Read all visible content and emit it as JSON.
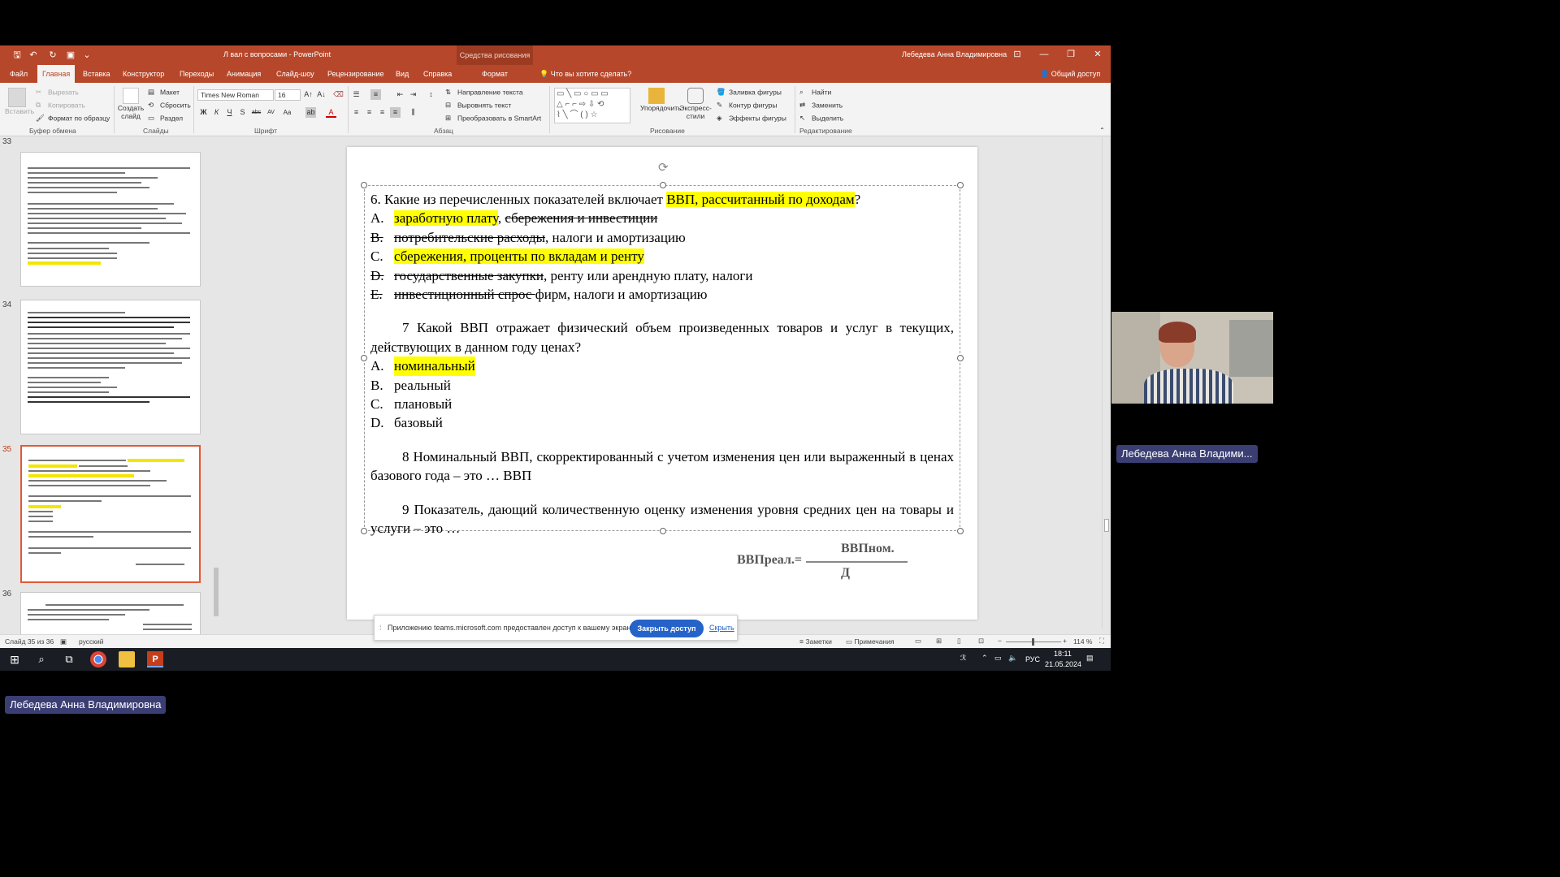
{
  "window": {
    "app_title": "Л вал с вопросами  -  PowerPoint",
    "context_tab_title": "Средства рисования",
    "user_name": "Лебедева Анна Владимировна"
  },
  "tabs": [
    "Файл",
    "Главная",
    "Вставка",
    "Конструктор",
    "Переходы",
    "Анимация",
    "Слайд-шоу",
    "Рецензирование",
    "Вид",
    "Справка",
    "Формат"
  ],
  "tell_me": "Что вы хотите сделать?",
  "share_label": "Общий доступ",
  "ribbon": {
    "clipboard": {
      "paste": "Вставить",
      "cut": "Вырезать",
      "copy": "Копировать",
      "format_painter": "Формат по образцу",
      "group": "Буфер обмена"
    },
    "slides": {
      "layout": "Макет",
      "reset": "Сбросить",
      "new_slide_line1": "Создать",
      "new_slide_line2": "слайд",
      "section": "Раздел",
      "group": "Слайды"
    },
    "font": {
      "name": "Times New Roman",
      "size": "16",
      "bold": "Ж",
      "italic": "К",
      "underline": "Ч",
      "shadow": "S",
      "strike": "abc",
      "spacing": "AV",
      "case": "Aa",
      "group": "Шрифт"
    },
    "paragraph": {
      "text_direction": "Направление текста",
      "align_text": "Выровнять текст",
      "smartart": "Преобразовать в SmartArt",
      "group": "Абзац"
    },
    "drawing": {
      "arrange_line1": "Упорядочить",
      "quick_styles_line1": "Экспресс-",
      "quick_styles_line2": "стили",
      "fill": "Заливка фигуры",
      "outline": "Контур фигуры",
      "effects": "Эффекты фигуры",
      "group": "Рисование"
    },
    "editing": {
      "find": "Найти",
      "replace": "Заменить",
      "select": "Выделить",
      "group": "Редактирование"
    }
  },
  "thumbnails": [
    {
      "number": "33"
    },
    {
      "number": "34"
    },
    {
      "number": "35"
    },
    {
      "number": "36"
    }
  ],
  "slide": {
    "q6": {
      "prefix": "6. Какие из перечисленных показателей включает ",
      "highlight": "ВВП, рассчитанный по доходам",
      "suffix": "?"
    },
    "q6_options": [
      {
        "letter": "A.",
        "parts": [
          {
            "t": "заработную плату",
            "s": "hl"
          },
          {
            "t": ", ",
            "s": ""
          },
          {
            "t": "сбережения и инвестиции",
            "s": "st"
          }
        ]
      },
      {
        "letter": "B.",
        "parts": [
          {
            "t": "потребительские расходы",
            "s": "st"
          },
          {
            "t": ", налоги и амортизацию",
            "s": ""
          }
        ]
      },
      {
        "letter": "C.",
        "parts": [
          {
            "t": "сбережения, проценты по вкладам и ренту",
            "s": "hl"
          }
        ]
      },
      {
        "letter": "D.",
        "parts": [
          {
            "t": "государственные закупки",
            "s": "st"
          },
          {
            "t": ", ренту или арендную плату, налоги",
            "s": ""
          }
        ]
      },
      {
        "letter": "E.",
        "parts": [
          {
            "t": "инвестиционный спрос ",
            "s": "st"
          },
          {
            "t": "фирм, налоги и амортизацию",
            "s": ""
          }
        ]
      }
    ],
    "q7": "7 Какой ВВП отражает физический объем произведенных товаров и услуг в текущих, действующих в данном году ценах?",
    "q7_options": [
      {
        "letter": "A.",
        "text": "номинальный",
        "style": "hl"
      },
      {
        "letter": "B.",
        "text": "реальный",
        "style": ""
      },
      {
        "letter": "C.",
        "text": "плановый",
        "style": ""
      },
      {
        "letter": "D.",
        "text": "базовый",
        "style": ""
      }
    ],
    "q8": "8 Номинальный ВВП, скорректированный с учетом изменения цен или выраженный в ценах базового года – это … ВВП",
    "q9": "9 Показатель, дающий количественную оценку изменения уровня средних цен на товары и услуги – это …",
    "formula": {
      "lhs": "ВВПреал.=",
      "numerator": "ВВПном.",
      "denominator": "Д"
    }
  },
  "status": {
    "slide_counter": "Слайд 35 из 36",
    "language": "русский",
    "notes": "Заметки",
    "comments": "Примечания",
    "zoom": "114 %"
  },
  "share_notice": {
    "text": "Приложению teams.microsoft.com предоставлен доступ к вашему экрану.",
    "stop_button": "Закрыть доступ",
    "hide_link": "Скрыть"
  },
  "taskbar": {
    "language": "РУС",
    "time": "18:11",
    "date": "21.05.2024"
  },
  "participants": {
    "video_name": "Лебедева Анна Владими...",
    "presenter_name": "Лебедева Анна Владимировна"
  },
  "colors": {
    "ppt_accent": "#b7472a",
    "highlight": "#ffff00",
    "teams_tag": "#3b3e73"
  }
}
